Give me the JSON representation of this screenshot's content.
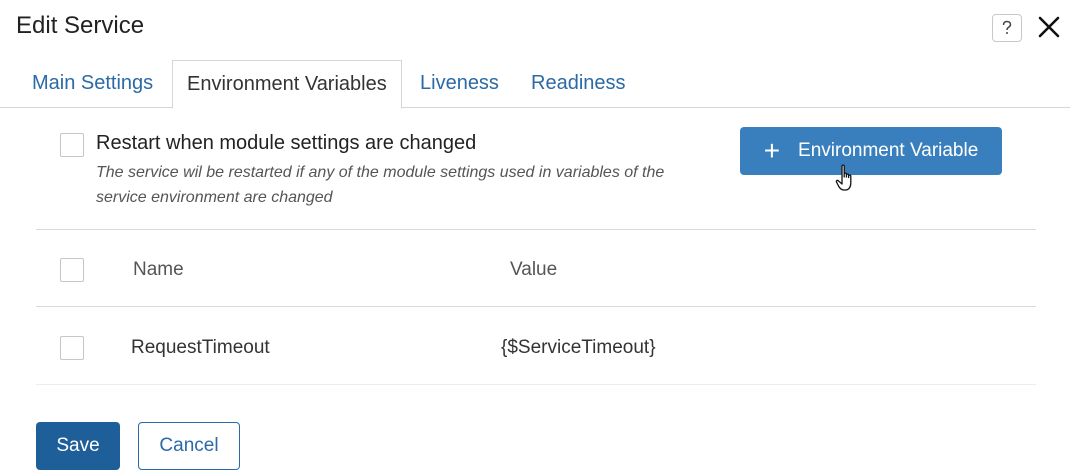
{
  "dialog": {
    "title": "Edit Service",
    "help_icon": "question-icon",
    "close_icon": "close-icon"
  },
  "tabs": [
    {
      "label": "Main Settings",
      "active": false
    },
    {
      "label": "Environment Variables",
      "active": true
    },
    {
      "label": "Liveness",
      "active": false
    },
    {
      "label": "Readiness",
      "active": false
    }
  ],
  "restart": {
    "label": "Restart when module settings are changed",
    "description": "The service wil be restarted if any of the module settings used in variables of the service environment are changed",
    "checked": false
  },
  "toolbar": {
    "add_label": "Environment Variable",
    "add_icon": "plus-icon"
  },
  "table": {
    "columns": [
      "Name",
      "Value"
    ],
    "rows": [
      {
        "name": "RequestTimeout",
        "value": "{$ServiceTimeout}"
      }
    ]
  },
  "footer": {
    "save_label": "Save",
    "cancel_label": "Cancel"
  },
  "colors": {
    "primary": "#3a7fbd",
    "save": "#1f5f99",
    "link": "#2b6aa6"
  }
}
